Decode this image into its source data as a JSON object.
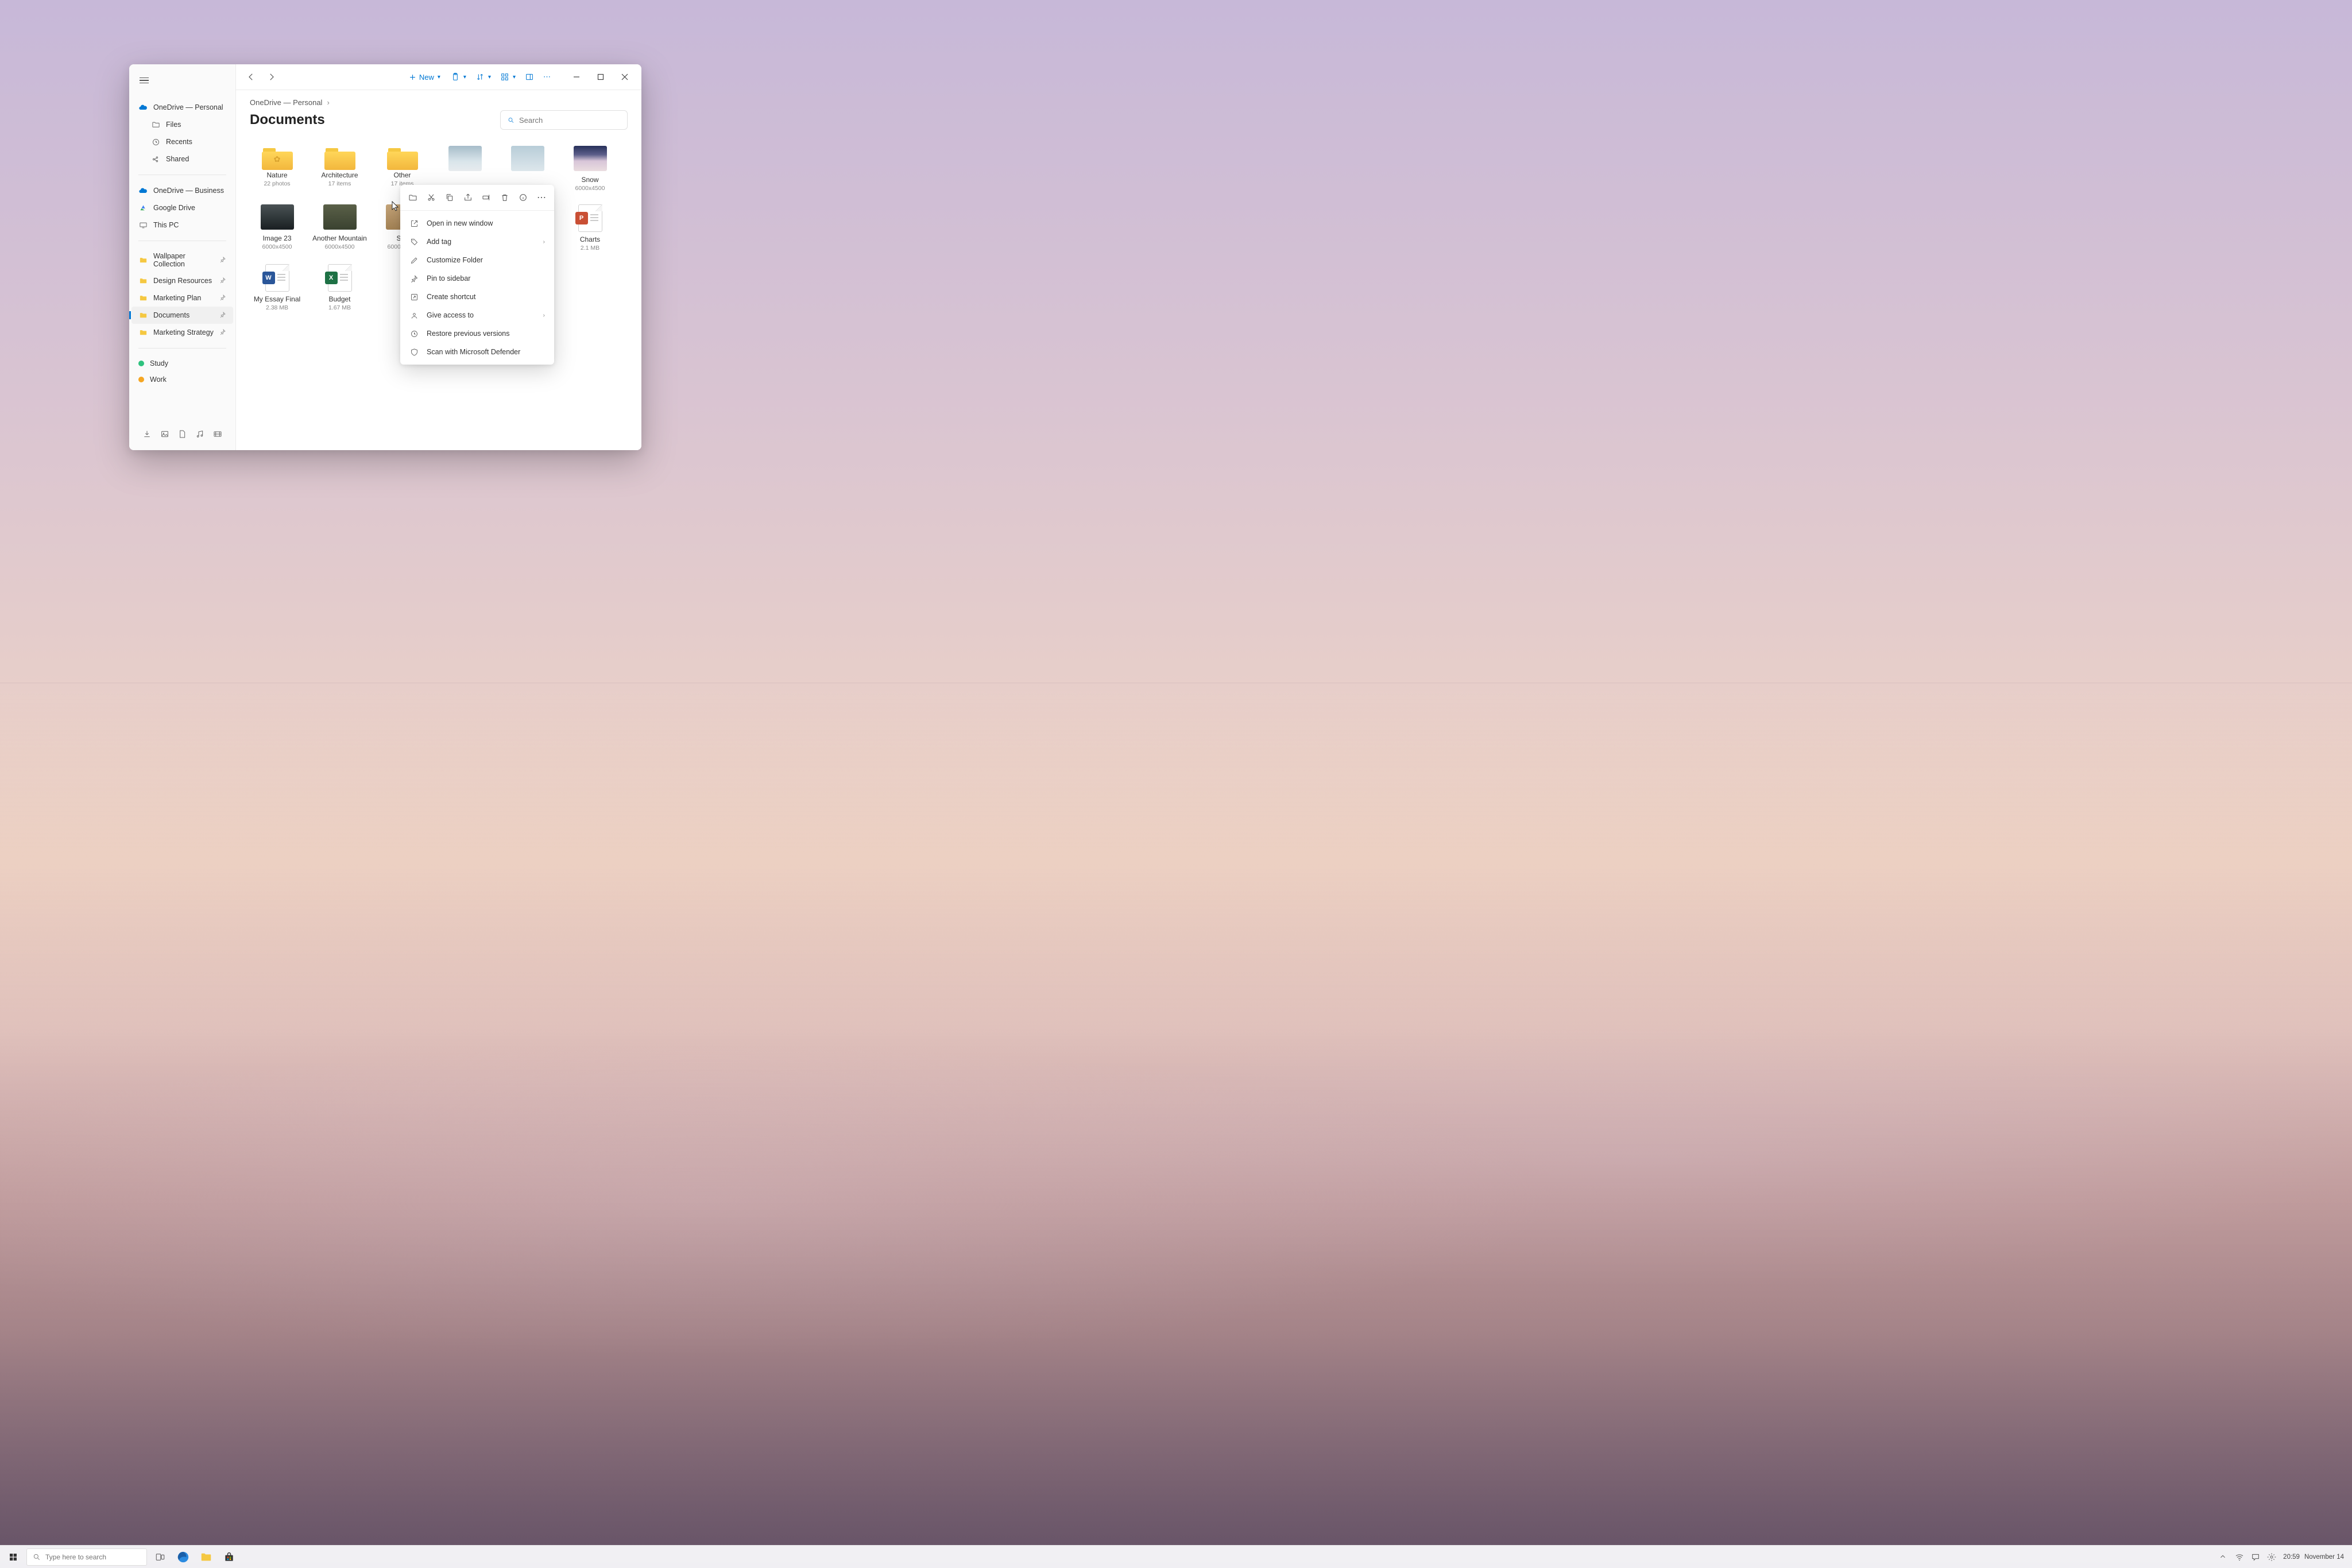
{
  "sidebar": {
    "primary": {
      "label": "OneDrive — Personal"
    },
    "primary_children": [
      {
        "label": "Files"
      },
      {
        "label": "Recents"
      },
      {
        "label": "Shared"
      }
    ],
    "locations": [
      {
        "label": "OneDrive — Business"
      },
      {
        "label": "Google Drive"
      },
      {
        "label": "This PC"
      }
    ],
    "pins": [
      {
        "label": "Wallpaper Collection"
      },
      {
        "label": "Design Resources"
      },
      {
        "label": "Marketing Plan"
      },
      {
        "label": "Documents"
      },
      {
        "label": "Marketing Strategy"
      }
    ],
    "tags": [
      {
        "label": "Study",
        "color": "#2ec27e"
      },
      {
        "label": "Work",
        "color": "#f5a623"
      }
    ]
  },
  "toolbar": {
    "new_label": "New"
  },
  "breadcrumb": "OneDrive — Personal",
  "page_title": "Documents",
  "search_placeholder": "Search",
  "items": [
    {
      "name": "Nature",
      "meta": "22 photos"
    },
    {
      "name": "Architecture",
      "meta": "17 items"
    },
    {
      "name": "Other",
      "meta": "17 items"
    },
    {
      "name": "—",
      "meta": ""
    },
    {
      "name": "—",
      "meta": ""
    },
    {
      "name": "Snow",
      "meta": "6000x4500"
    },
    {
      "name": "Image 23",
      "meta": "6000x4500"
    },
    {
      "name": "Another Mountain",
      "meta": "6000x4500"
    },
    {
      "name": "Sky",
      "meta": "6000x4500"
    },
    {
      "name": "—",
      "meta": ""
    },
    {
      "name": "—",
      "meta": ""
    },
    {
      "name": "Charts",
      "meta": "2.1 MB"
    },
    {
      "name": "My Essay Final",
      "meta": "2.38 MB"
    },
    {
      "name": "Budget",
      "meta": "1.67 MB"
    }
  ],
  "context_menu": {
    "items": [
      {
        "label": "Open in new window"
      },
      {
        "label": "Add tag",
        "submenu": true
      },
      {
        "label": "Customize Folder"
      },
      {
        "label": "Pin to sidebar"
      },
      {
        "label": "Create shortcut"
      },
      {
        "label": "Give access to",
        "submenu": true
      },
      {
        "label": "Restore previous versions"
      },
      {
        "label": "Scan with Microsoft Defender"
      }
    ]
  },
  "taskbar": {
    "search_placeholder": "Type here to search",
    "time": "20:59",
    "date": "November 14"
  }
}
